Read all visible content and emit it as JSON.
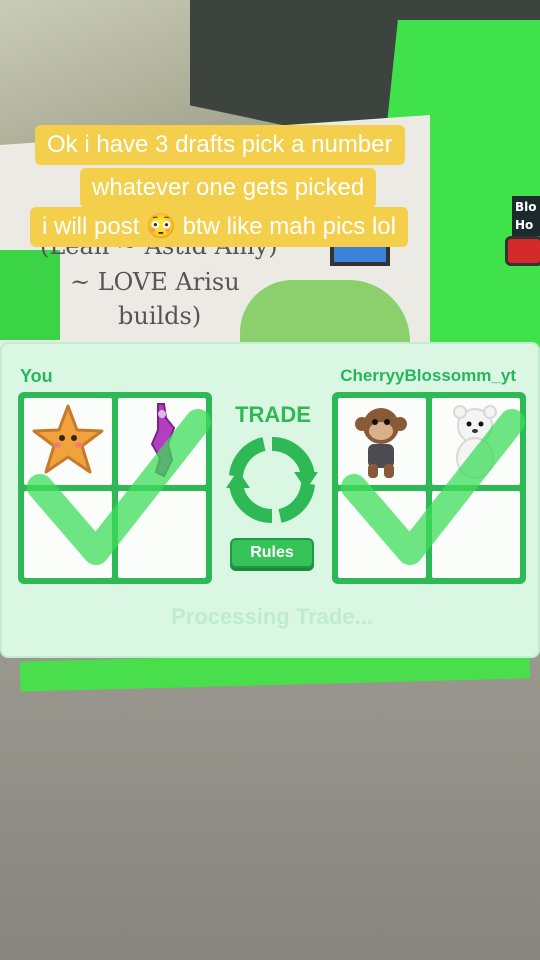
{
  "caption": {
    "line1": "Ok i have 3 drafts pick a number",
    "line2": "whatever one gets picked",
    "line3": "i will post 😳 btw like mah pics lol"
  },
  "background": {
    "sign_line1": "(Lean ~ Astid Amy)",
    "sign_line2": "~ LOVE Arisu",
    "sign_line3": "builds)",
    "side_label": "Blo Ho"
  },
  "trade": {
    "title": "TRADE",
    "rules_label": "Rules",
    "status": "Processing Trade...",
    "you": {
      "label": "You",
      "accepted": true,
      "slots": [
        {
          "item": "starfish-pet"
        },
        {
          "item": "purple-pet-figure"
        },
        {
          "item": ""
        },
        {
          "item": ""
        }
      ]
    },
    "partner": {
      "label": "CherryyBlossomm_yt",
      "accepted": true,
      "slots": [
        {
          "item": "monkey-pet"
        },
        {
          "item": "polar-bear-pet"
        },
        {
          "item": ""
        },
        {
          "item": ""
        }
      ]
    }
  },
  "colors": {
    "accent_green": "#2fb956",
    "panel_bg": "#d9f7e3",
    "caption_bg": "#f3cf4b"
  }
}
